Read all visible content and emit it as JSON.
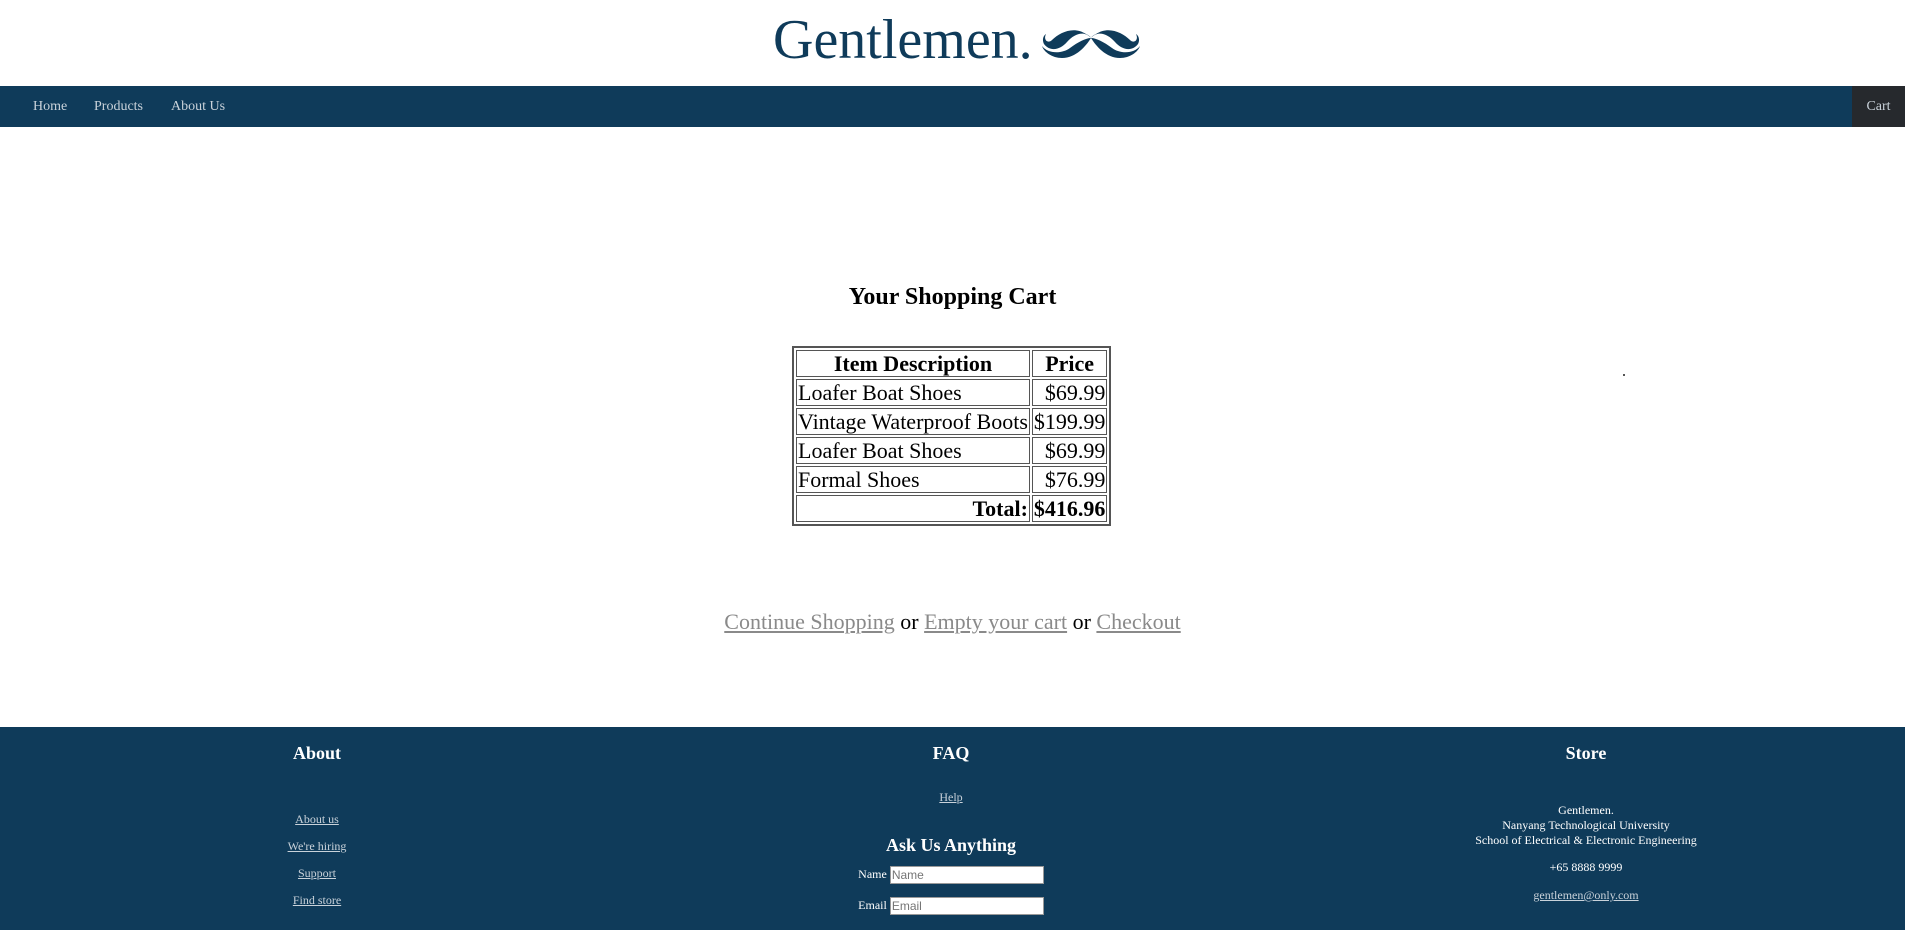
{
  "brand": {
    "name": "Gentlemen.",
    "color": "#0f3b5a"
  },
  "nav": {
    "items": [
      {
        "label": "Home"
      },
      {
        "label": "Products"
      },
      {
        "label": "About Us"
      }
    ],
    "cart_label": "Cart"
  },
  "main": {
    "title": "Your Shopping Cart",
    "table": {
      "headers": [
        "Item Description",
        "Price"
      ],
      "rows": [
        {
          "item": "Loafer Boat Shoes",
          "price": "$69.99"
        },
        {
          "item": "Vintage Waterproof Boots",
          "price": "$199.99"
        },
        {
          "item": "Loafer Boat Shoes",
          "price": "$69.99"
        },
        {
          "item": "Formal Shoes",
          "price": "$76.99"
        }
      ],
      "total_label": "Total:",
      "total_value": "$416.96"
    },
    "actions": {
      "continue": "Continue Shopping",
      "sep1": "or",
      "empty": "Empty your cart",
      "sep2": "or",
      "checkout": "Checkout"
    }
  },
  "footer": {
    "about": {
      "title": "About",
      "links": [
        "About us",
        "We're hiring",
        "Support",
        "Find store"
      ]
    },
    "faq": {
      "title": "FAQ",
      "help": "Help",
      "ask_title": "Ask Us Anything",
      "name_label": "Name",
      "name_placeholder": "Name",
      "email_label": "Email",
      "email_placeholder": "Email"
    },
    "store": {
      "title": "Store",
      "lines": [
        "Gentlemen.",
        "Nanyang Technological University",
        "School of Electrical & Electronic Engineering"
      ],
      "phone": "+65 8888 9999",
      "email": "gentlemen@only.com"
    }
  }
}
